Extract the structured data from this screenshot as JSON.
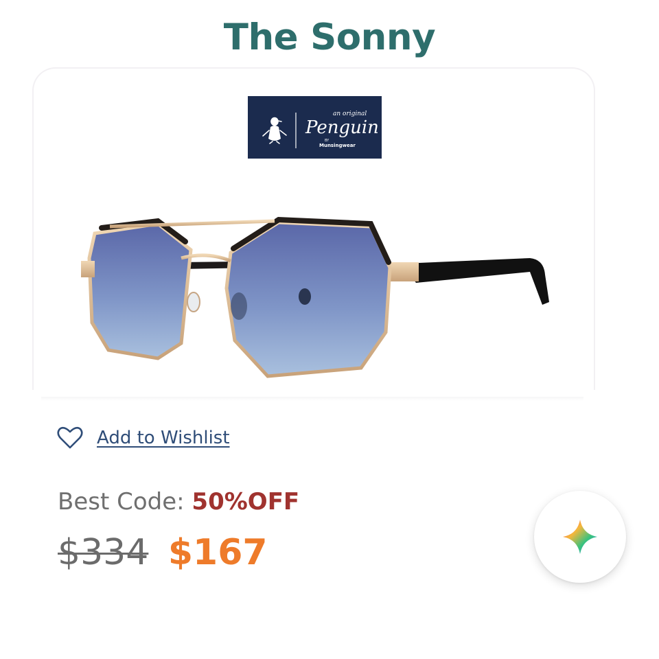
{
  "product": {
    "title": "The Sonny",
    "image_alt": "Gold metal aviator sunglasses with blue gradient lenses and black temples",
    "brand": {
      "tagline": "an original",
      "name": "Penguin",
      "sub_by": "BY",
      "sub_name": "Munsingwear"
    }
  },
  "wishlist": {
    "label": "Add to Wishlist",
    "icon": "heart-outline-icon"
  },
  "promo": {
    "label": "Best Code: ",
    "code": "50%OFF"
  },
  "price": {
    "original": "$334",
    "sale": "$167"
  },
  "assistant_button": {
    "icon": "sparkle-icon"
  },
  "colors": {
    "title": "#2e6e6c",
    "link": "#2f4d78",
    "promo_code": "#a0332f",
    "sale_price": "#ee7b2a",
    "brand_bg": "#1b2b4e"
  }
}
